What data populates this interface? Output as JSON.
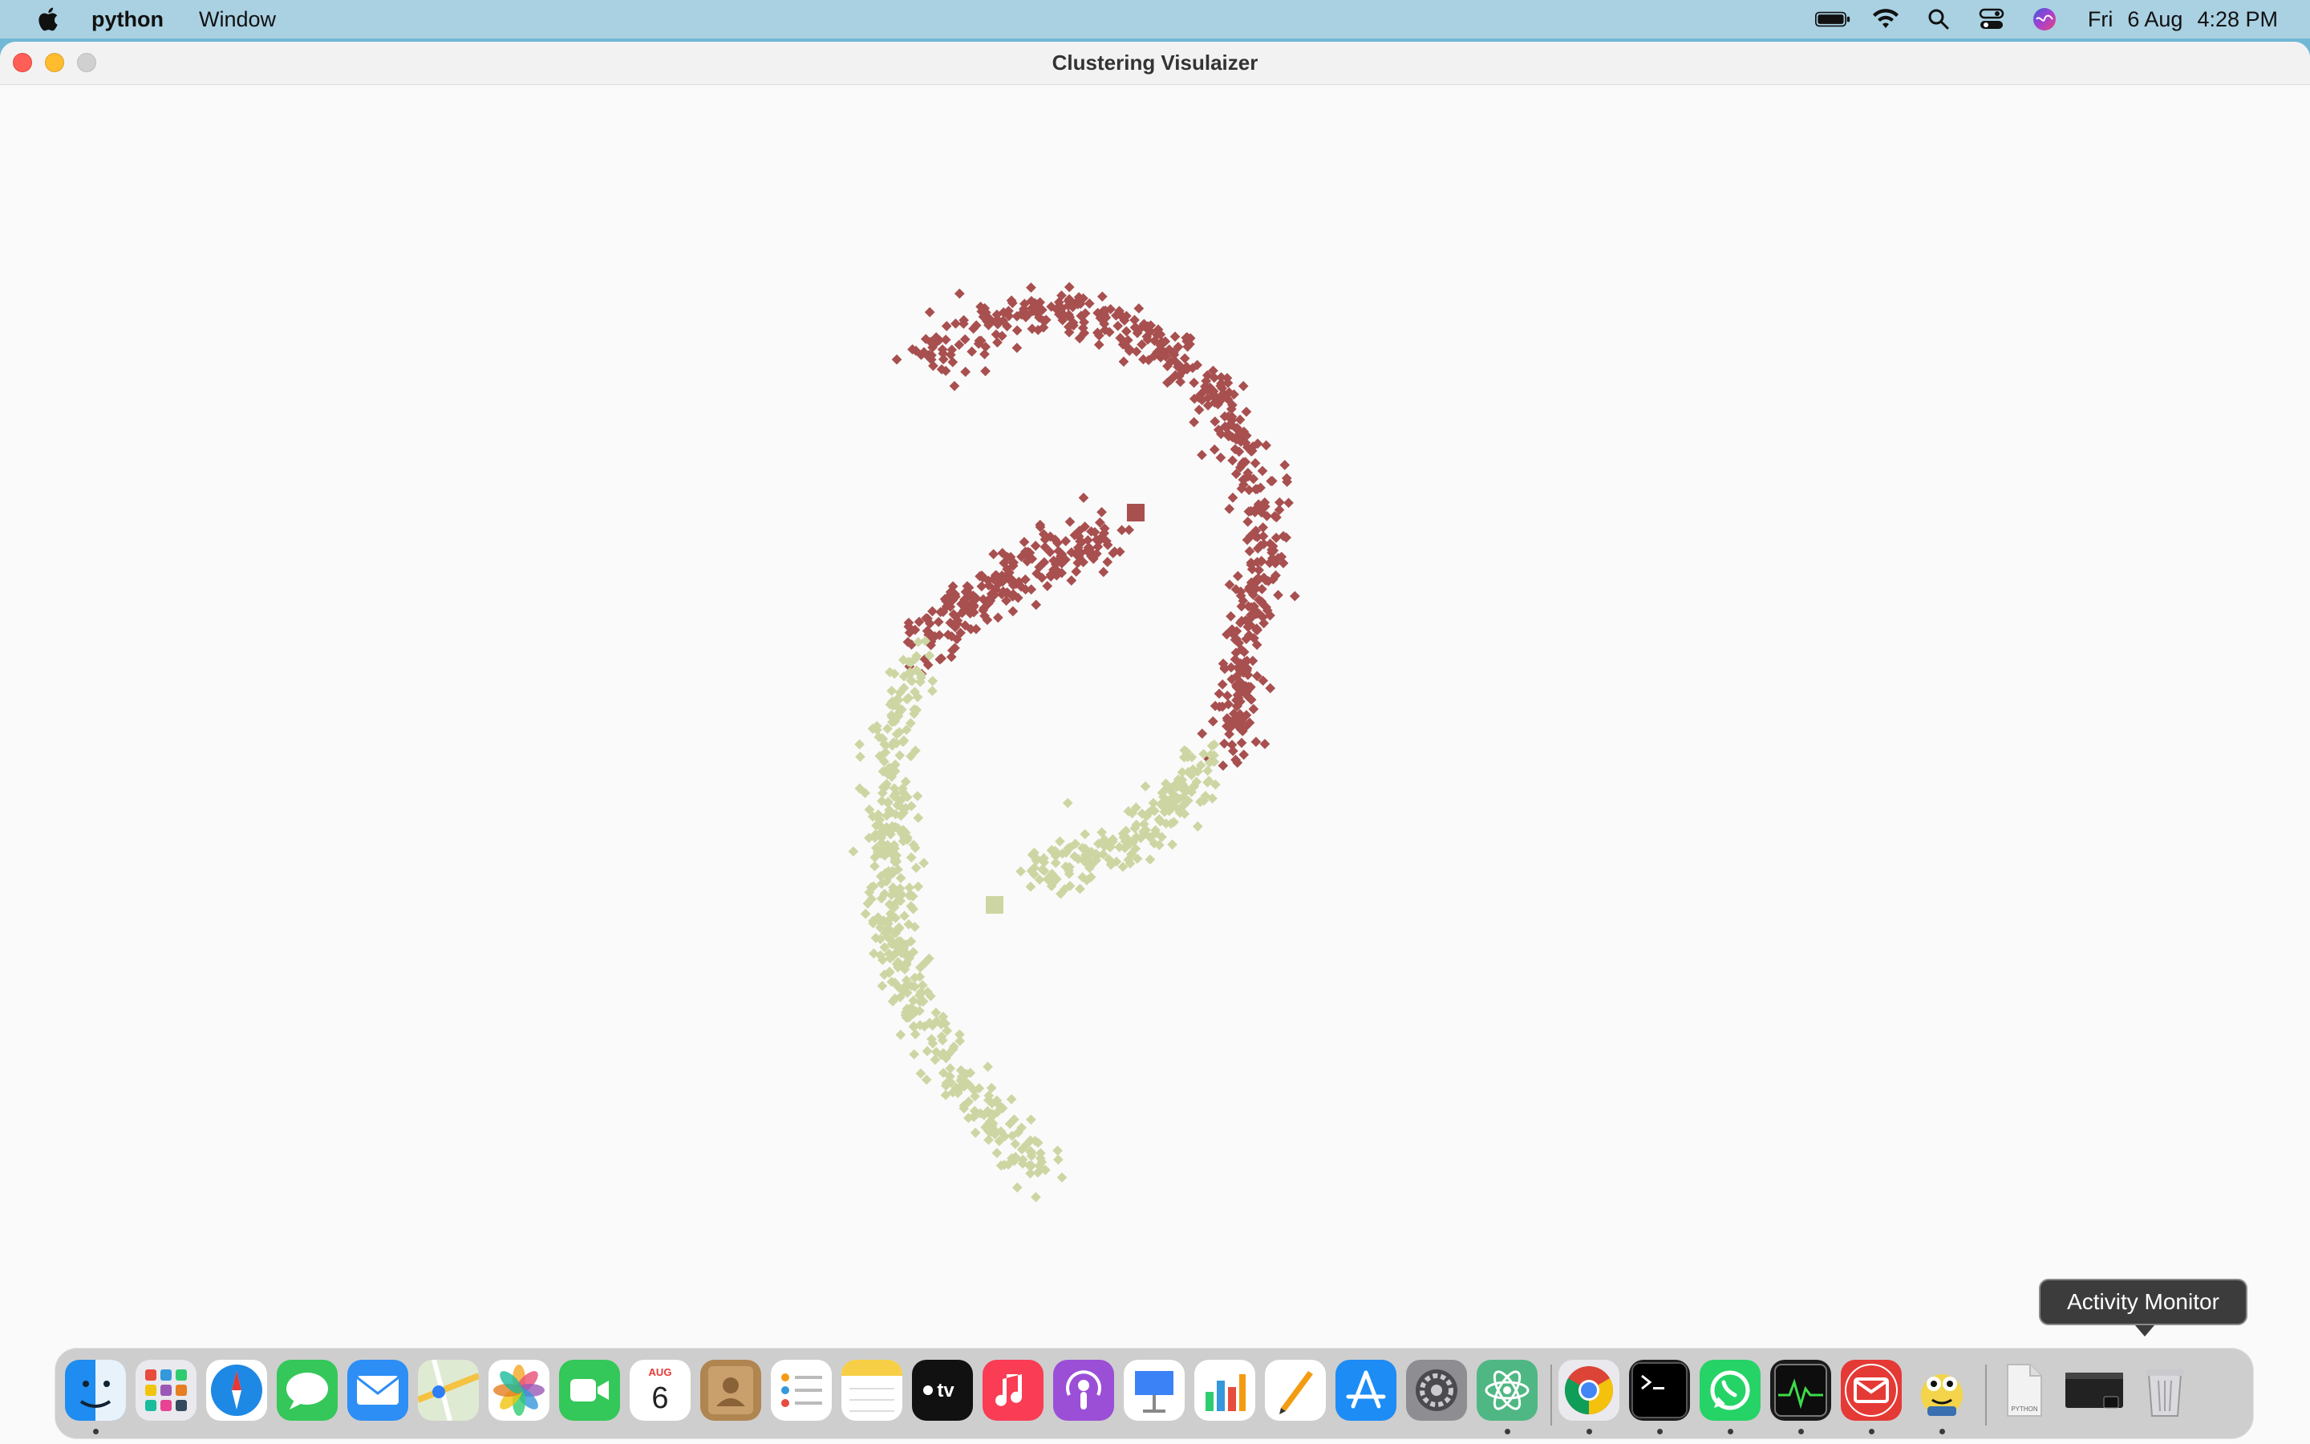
{
  "menubar": {
    "apple_icon": "apple-logo-icon",
    "app_name": "python",
    "menus": [
      "Window"
    ],
    "status_icons": [
      "battery-icon",
      "wifi-icon",
      "spotlight-search-icon",
      "control-center-icon",
      "siri-icon"
    ],
    "clock": {
      "day": "Fri",
      "date": "6 Aug",
      "time": "4:28 PM"
    }
  },
  "window": {
    "title": "Clustering Visulaizer",
    "buttons": [
      "close",
      "minimize",
      "zoom"
    ]
  },
  "chart_data": {
    "type": "scatter",
    "description": "Two interleaved moon-shaped clusters of points (e.g. make_moons) colored by cluster label; one larger square marks each cluster center",
    "title": "",
    "xlabel": "",
    "ylabel": "",
    "axes_visible": false,
    "grid": false,
    "series": [
      {
        "color": "#a84f4f",
        "marker": "diamond",
        "shape": "upper crescent plus inner arc",
        "centroid_marker": "square"
      },
      {
        "color": "#cdd6a3",
        "marker": "diamond",
        "shape": "lower crescent plus inner arc",
        "centroid_marker": "square"
      }
    ]
  },
  "dock": {
    "items": [
      {
        "name": "Finder",
        "icon": "finder-icon",
        "running": true
      },
      {
        "name": "Launchpad",
        "icon": "launchpad-icon",
        "running": false
      },
      {
        "name": "Safari",
        "icon": "safari-icon",
        "running": false
      },
      {
        "name": "Messages",
        "icon": "messages-icon",
        "running": false
      },
      {
        "name": "Mail",
        "icon": "mail-icon",
        "running": false
      },
      {
        "name": "Maps",
        "icon": "maps-icon",
        "running": false
      },
      {
        "name": "Photos",
        "icon": "photos-icon",
        "running": false
      },
      {
        "name": "FaceTime",
        "icon": "facetime-icon",
        "running": false
      },
      {
        "name": "Calendar",
        "icon": "calendar-icon",
        "running": false,
        "month": "AUG",
        "day": "6"
      },
      {
        "name": "Contacts",
        "icon": "contacts-icon",
        "running": false
      },
      {
        "name": "Reminders",
        "icon": "reminders-icon",
        "running": false
      },
      {
        "name": "Notes",
        "icon": "notes-icon",
        "running": false
      },
      {
        "name": "TV",
        "icon": "apple-tv-icon",
        "running": false,
        "label": "tv"
      },
      {
        "name": "Music",
        "icon": "music-icon",
        "running": false
      },
      {
        "name": "Podcasts",
        "icon": "podcasts-icon",
        "running": false
      },
      {
        "name": "Keynote",
        "icon": "keynote-icon",
        "running": false
      },
      {
        "name": "Numbers",
        "icon": "numbers-icon",
        "running": false
      },
      {
        "name": "Pages",
        "icon": "pages-icon",
        "running": false
      },
      {
        "name": "App Store",
        "icon": "app-store-icon",
        "running": false
      },
      {
        "name": "System Preferences",
        "icon": "system-preferences-icon",
        "running": false
      },
      {
        "name": "Atom",
        "icon": "atom-icon",
        "running": true
      },
      {
        "name": "Google Chrome",
        "icon": "chrome-icon",
        "running": true
      },
      {
        "name": "Terminal",
        "icon": "terminal-icon",
        "running": true
      },
      {
        "name": "WhatsApp",
        "icon": "whatsapp-icon",
        "running": true
      },
      {
        "name": "Activity Monitor",
        "icon": "activity-monitor-icon",
        "running": true
      },
      {
        "name": "Airmail",
        "icon": "airmail-icon",
        "running": true
      },
      {
        "name": "Python Launcher",
        "icon": "python-launcher-icon",
        "running": true
      },
      {
        "name": "python file",
        "icon": "python-file-icon",
        "running": false,
        "label": "PYTHON"
      },
      {
        "name": "window preview",
        "icon": "window-thumbnail-icon",
        "running": false
      },
      {
        "name": "Trash",
        "icon": "trash-icon",
        "running": false
      }
    ],
    "tooltip": "Activity Monitor"
  }
}
